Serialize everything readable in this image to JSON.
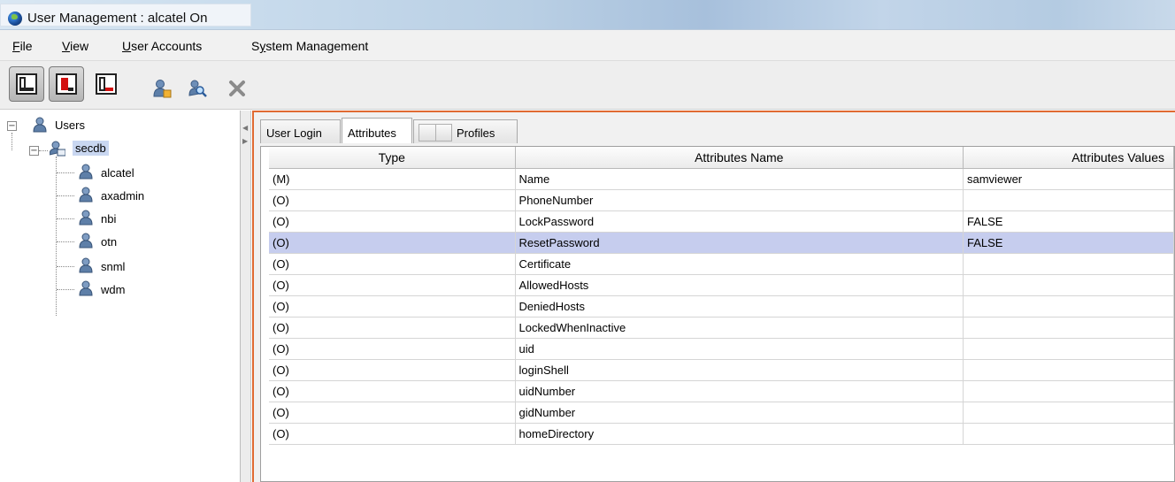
{
  "window": {
    "title": "User Management : alcatel On"
  },
  "menu": [
    {
      "label": "File",
      "mnemonic": "F",
      "rest": "ile"
    },
    {
      "label": "View",
      "mnemonic": "V",
      "rest": "iew"
    },
    {
      "label": "User Accounts",
      "mnemonic": "U",
      "rest": "ser Accounts"
    },
    {
      "label": "System Management",
      "mnemonic": "y",
      "pre": "S",
      "rest": "stem Management"
    }
  ],
  "toolbar": {
    "buttons": [
      "layout-full",
      "layout-left-selected",
      "layout-bottom"
    ],
    "actions": [
      "user-add-icon",
      "user-search-icon",
      "delete-icon"
    ]
  },
  "tree": {
    "root": "Users",
    "group": "secdb",
    "users": [
      "alcatel",
      "axadmin",
      "nbi",
      "otn",
      "snml",
      "wdm"
    ]
  },
  "tabs": {
    "login": "User Login",
    "attributes": "Attributes",
    "profiles": "Profiles",
    "active": "Attributes"
  },
  "table": {
    "headers": [
      "Type",
      "Attributes Name",
      "Attributes Values"
    ],
    "rows": [
      [
        "(M)",
        "Name",
        "samviewer"
      ],
      [
        "(O)",
        "PhoneNumber",
        ""
      ],
      [
        "(O)",
        "LockPassword",
        "FALSE"
      ],
      [
        "(O)",
        "ResetPassword",
        "FALSE"
      ],
      [
        "(O)",
        "Certificate",
        ""
      ],
      [
        "(O)",
        "AllowedHosts",
        ""
      ],
      [
        "(O)",
        "DeniedHosts",
        ""
      ],
      [
        "(O)",
        "LockedWhenInactive",
        ""
      ],
      [
        "(O)",
        "uid",
        ""
      ],
      [
        "(O)",
        "loginShell",
        ""
      ],
      [
        "(O)",
        "uidNumber",
        ""
      ],
      [
        "(O)",
        "gidNumber",
        ""
      ],
      [
        "(O)",
        "homeDirectory",
        ""
      ]
    ],
    "selected_row": 3
  },
  "colors": {
    "accent_border": "#e06a32",
    "selection": "#c6cdee",
    "tree_selection": "#c9d7f1"
  }
}
